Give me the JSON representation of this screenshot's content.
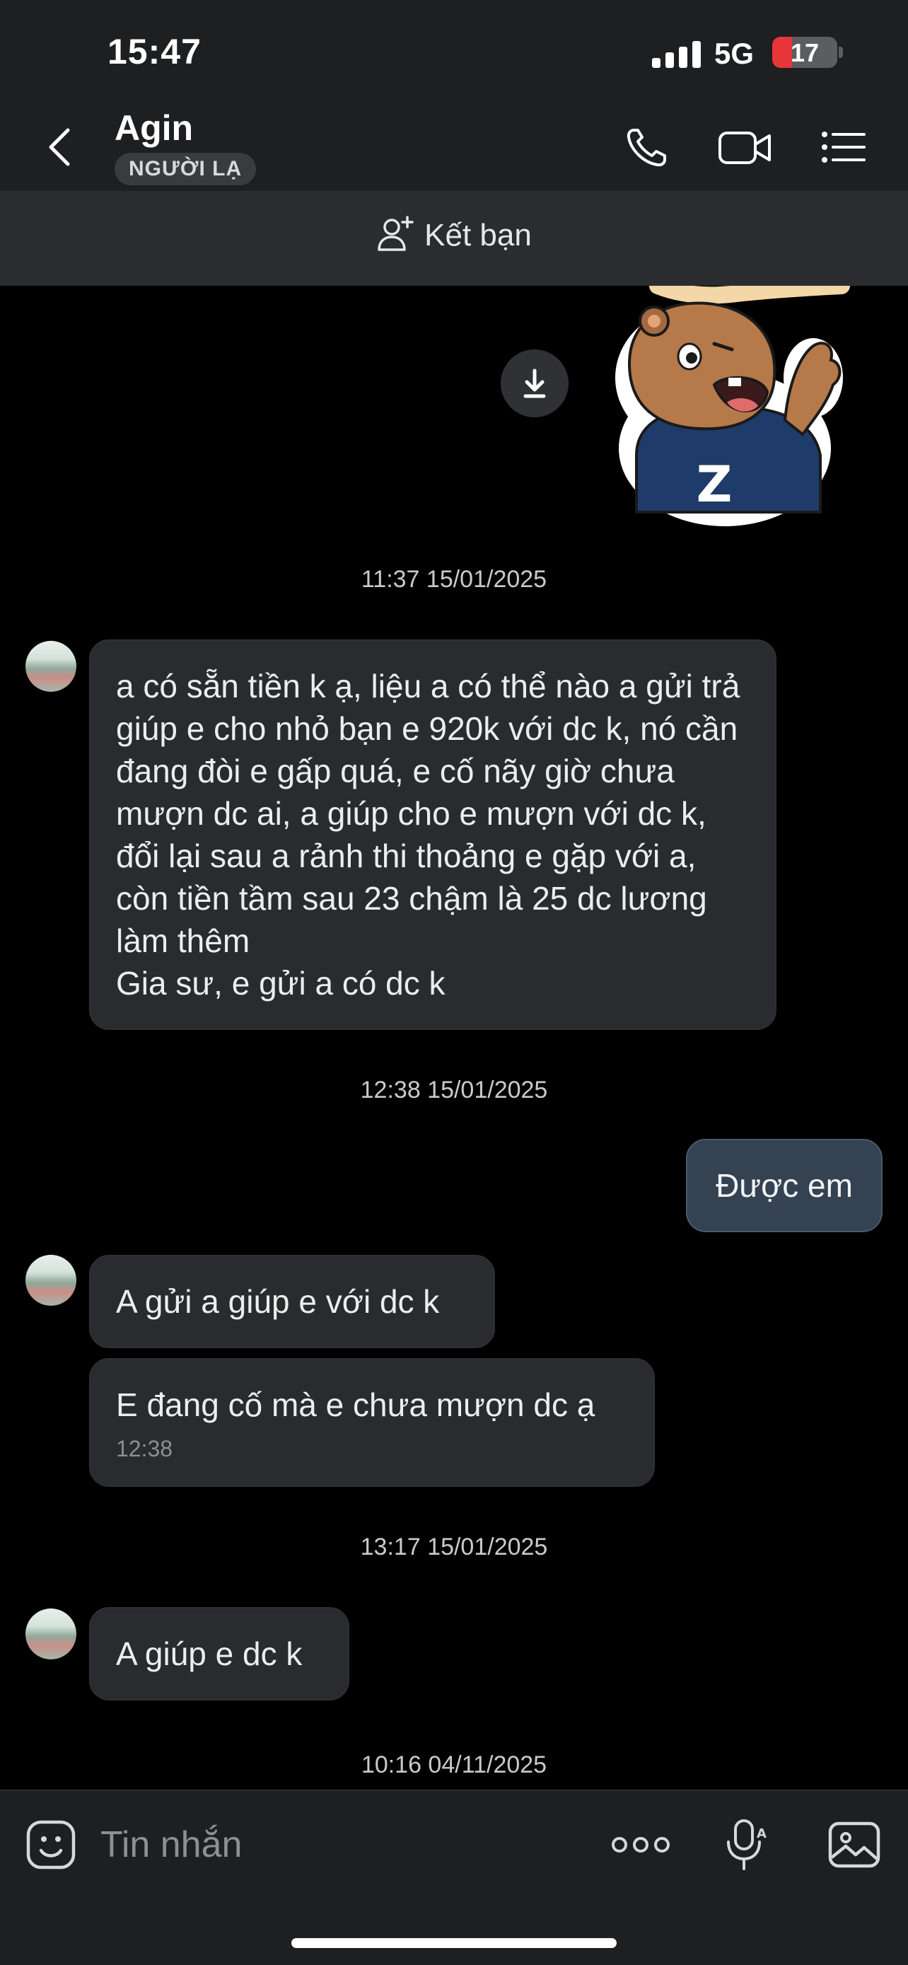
{
  "status_bar": {
    "time": "15:47",
    "network": "5G",
    "battery": "17",
    "battery_level": 0.17
  },
  "header": {
    "name": "Agin",
    "badge": "NGƯỜI LẠ"
  },
  "friend_bar": {
    "label": "Kết bạn"
  },
  "messages": [
    {
      "timestamp": "11:37 15/01/2025"
    },
    {
      "text": "a có sẵn tiền k ạ, liệu a có thể nào a gửi trả giúp e cho nhỏ bạn e 920k với dc k, nó cần đang đòi e gấp quá, e cố nãy giờ chưa mượn dc ai, a giúp cho e mượn với dc k, đổi lại sau a rảnh thi thoảng e gặp với a, còn tiền tầm sau 23 chậm là 25 dc lương làm thêm\nGia sư, e gửi a có dc k"
    },
    {
      "timestamp": "12:38 15/01/2025"
    },
    {
      "text": "Được em"
    },
    {
      "text": "A gửi a giúp e với dc k"
    },
    {
      "text": "E đang cố mà e chưa mượn dc ạ",
      "time": "12:38"
    },
    {
      "timestamp": "13:17 15/01/2025"
    },
    {
      "text": "A giúp e dc k"
    },
    {
      "timestamp": "10:16 04/11/2025"
    }
  ],
  "input": {
    "placeholder": "Tin nhắn"
  },
  "colors": {
    "background": "#000000",
    "header": "#1e1f21",
    "incoming_bubble": "#2a2b2e",
    "outgoing_bubble": "#344252",
    "battery_low": "#e8353a"
  },
  "icons": [
    "chevron-left-icon",
    "phone-icon",
    "video-icon",
    "menu-list-icon",
    "add-friend-icon",
    "download-icon",
    "emoji-icon",
    "more-dots-icon",
    "voice-mic-icon",
    "image-gallery-icon"
  ]
}
